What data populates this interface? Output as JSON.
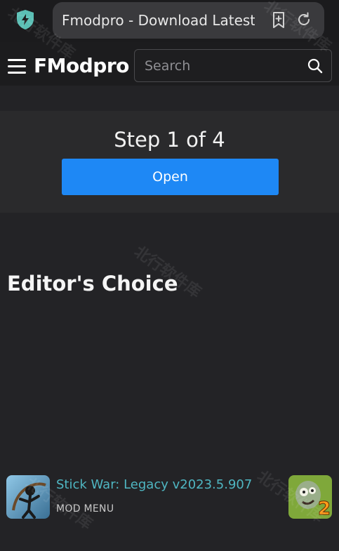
{
  "browser": {
    "url_title": "Fmodpro - Download Latest",
    "shield_icon": "shield-bolt-icon",
    "bookmark_icon": "bookmark-add-icon",
    "reload_icon": "reload-icon",
    "shield_color": "#5bbfb5"
  },
  "header": {
    "menu_icon": "hamburger-menu-icon",
    "logo": "FModpro",
    "search_placeholder": "Search",
    "search_icon": "search-icon"
  },
  "step": {
    "title": "Step 1 of 4",
    "button_label": "Open",
    "button_color": "#1e88f5"
  },
  "editors_choice": {
    "heading": "Editor's Choice",
    "apps": [
      {
        "title": "Stick War: Legacy v2023.5.907",
        "subtitle": "MOD MENU",
        "icon": "stick-war-app-icon",
        "title_color": "#4fb6c2"
      },
      {
        "icon": "plants-vs-zombies-2-app-icon"
      }
    ]
  },
  "watermark": {
    "text": "北行软件库"
  }
}
